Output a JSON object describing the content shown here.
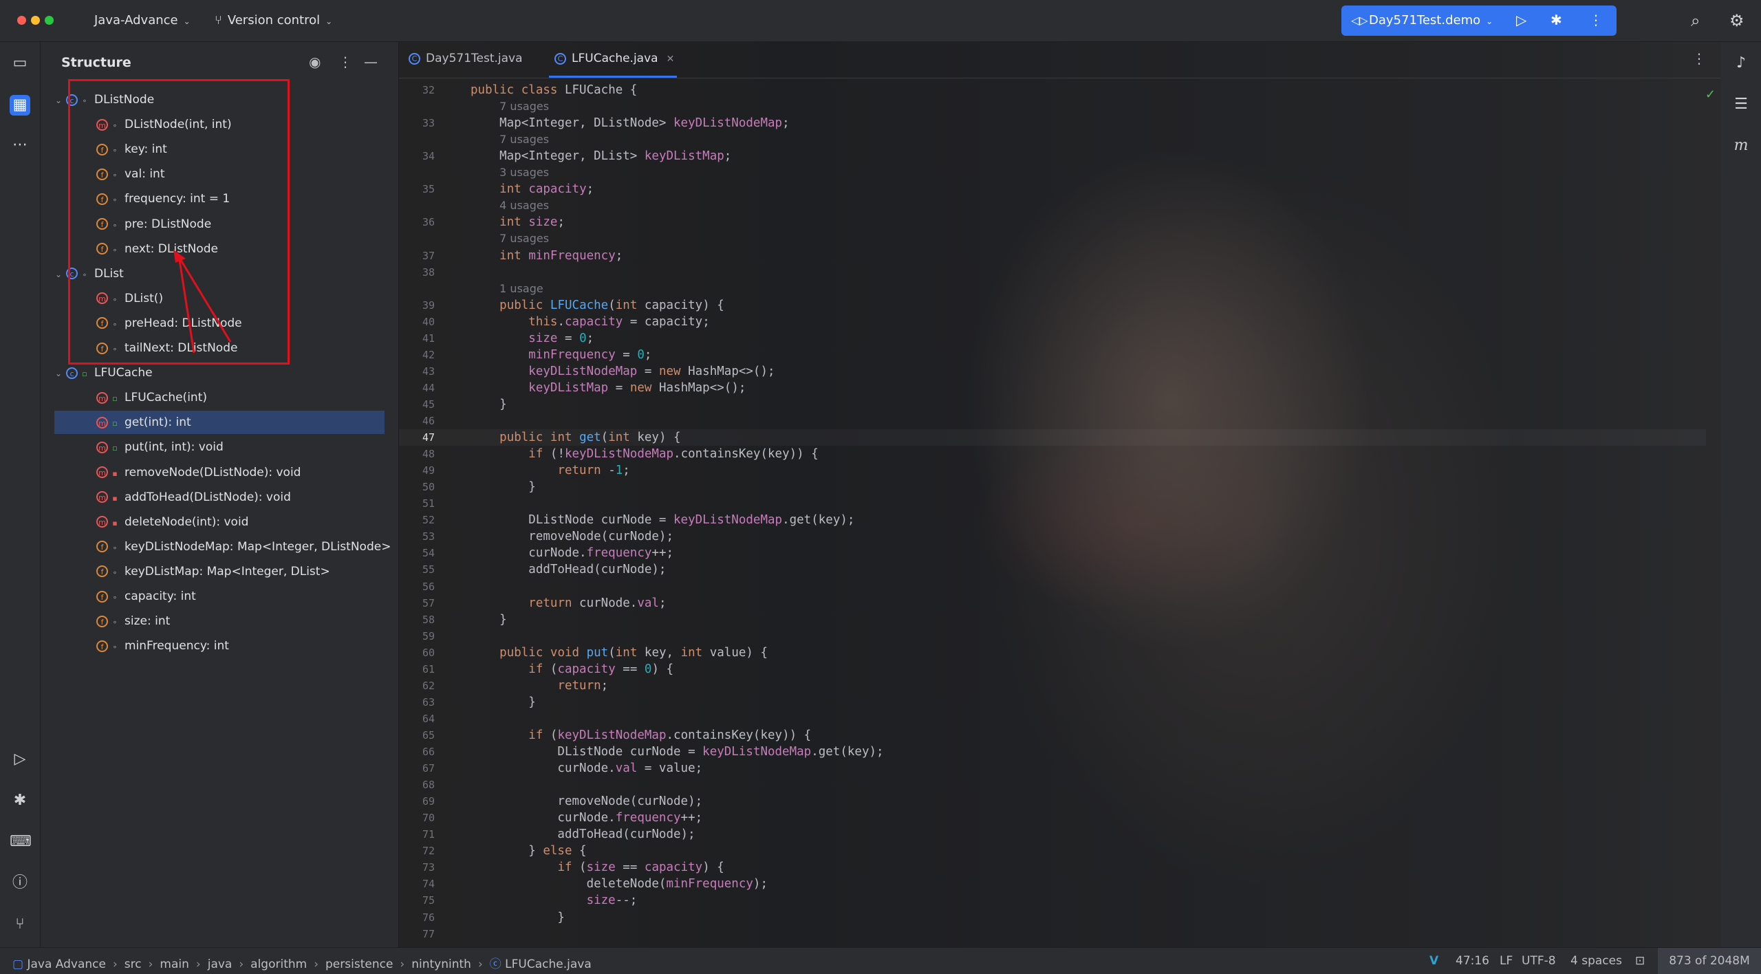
{
  "titlebar": {
    "project": "Java-Advance",
    "version_control": "Version control",
    "run_config": "Day571Test.demo"
  },
  "structure": {
    "title": "Structure",
    "items": [
      {
        "label": "DListNode",
        "kind": "c",
        "depth": 0,
        "vis": "pkg"
      },
      {
        "label": "DListNode(int, int)",
        "kind": "m",
        "depth": 1,
        "vis": "pkg"
      },
      {
        "label": "key: int",
        "kind": "f",
        "depth": 1,
        "vis": "pkg"
      },
      {
        "label": "val: int",
        "kind": "f",
        "depth": 1,
        "vis": "pkg"
      },
      {
        "label": "frequency: int = 1",
        "kind": "f",
        "depth": 1,
        "vis": "pkg"
      },
      {
        "label": "pre: DListNode",
        "kind": "f",
        "depth": 1,
        "vis": "pkg"
      },
      {
        "label": "next: DListNode",
        "kind": "f",
        "depth": 1,
        "vis": "pkg"
      },
      {
        "label": "DList",
        "kind": "c",
        "depth": 0,
        "vis": "pkg"
      },
      {
        "label": "DList()",
        "kind": "m",
        "depth": 1,
        "vis": "pkg"
      },
      {
        "label": "preHead: DListNode",
        "kind": "f",
        "depth": 1,
        "vis": "pkg"
      },
      {
        "label": "tailNext: DListNode",
        "kind": "f",
        "depth": 1,
        "vis": "pkg"
      },
      {
        "label": "LFUCache",
        "kind": "c",
        "depth": 0,
        "vis": "pub"
      },
      {
        "label": "LFUCache(int)",
        "kind": "m",
        "depth": 1,
        "vis": "pub"
      },
      {
        "label": "get(int): int",
        "kind": "m",
        "depth": 1,
        "vis": "pub",
        "selected": true
      },
      {
        "label": "put(int, int): void",
        "kind": "m",
        "depth": 1,
        "vis": "pub"
      },
      {
        "label": "removeNode(DListNode): void",
        "kind": "m",
        "depth": 1,
        "vis": "pri"
      },
      {
        "label": "addToHead(DListNode): void",
        "kind": "m",
        "depth": 1,
        "vis": "pri"
      },
      {
        "label": "deleteNode(int): void",
        "kind": "m",
        "depth": 1,
        "vis": "pri"
      },
      {
        "label": "keyDListNodeMap: Map<Integer, DListNode>",
        "kind": "f",
        "depth": 1,
        "vis": "pkg"
      },
      {
        "label": "keyDListMap: Map<Integer, DList>",
        "kind": "f",
        "depth": 1,
        "vis": "pkg"
      },
      {
        "label": "capacity: int",
        "kind": "f",
        "depth": 1,
        "vis": "pkg"
      },
      {
        "label": "size: int",
        "kind": "f",
        "depth": 1,
        "vis": "pkg"
      },
      {
        "label": "minFrequency: int",
        "kind": "f",
        "depth": 1,
        "vis": "pkg"
      }
    ]
  },
  "tabs": [
    {
      "label": "Day571Test.java",
      "active": false
    },
    {
      "label": "LFUCache.java",
      "active": true
    }
  ],
  "code_lines": [
    {
      "n": "32",
      "html": "<span class='kw'>public class</span> LFUCache {"
    },
    {
      "n": "",
      "hint": "7 usages",
      "indent": 4
    },
    {
      "n": "33",
      "html": "    Map&lt;Integer, DListNode&gt; <span class='fld'>keyDListNodeMap</span>;"
    },
    {
      "n": "",
      "hint": "7 usages",
      "indent": 4
    },
    {
      "n": "34",
      "html": "    Map&lt;Integer, DList&gt; <span class='fld'>keyDListMap</span>;"
    },
    {
      "n": "",
      "hint": "3 usages",
      "indent": 4
    },
    {
      "n": "35",
      "html": "    <span class='kw'>int</span> <span class='fld'>capacity</span>;"
    },
    {
      "n": "",
      "hint": "4 usages",
      "indent": 4
    },
    {
      "n": "36",
      "html": "    <span class='kw'>int</span> <span class='fld'>size</span>;"
    },
    {
      "n": "",
      "hint": "7 usages",
      "indent": 4
    },
    {
      "n": "37",
      "html": "    <span class='kw'>int</span> <span class='fld'>minFrequency</span>;"
    },
    {
      "n": "38",
      "html": ""
    },
    {
      "n": "",
      "hint": "1 usage",
      "indent": 4
    },
    {
      "n": "39",
      "html": "    <span class='kw'>public</span> <span class='fnd'>LFUCache</span>(<span class='kw'>int</span> capacity) {"
    },
    {
      "n": "40",
      "html": "        <span class='kw'>this</span>.<span class='fld'>capacity</span> = capacity;"
    },
    {
      "n": "41",
      "html": "        <span class='fld'>size</span> = <span class='num'>0</span>;"
    },
    {
      "n": "42",
      "html": "        <span class='fld'>minFrequency</span> = <span class='num'>0</span>;"
    },
    {
      "n": "43",
      "html": "        <span class='fld'>keyDListNodeMap</span> = <span class='kw'>new</span> HashMap&lt;&gt;();"
    },
    {
      "n": "44",
      "html": "        <span class='fld'>keyDListMap</span> = <span class='kw'>new</span> HashMap&lt;&gt;();"
    },
    {
      "n": "45",
      "html": "    }"
    },
    {
      "n": "46",
      "html": ""
    },
    {
      "n": "47",
      "html": "    <span class='kw'>public int</span> <span class='fnd'>get</span>(<span class='kw'>int</span> key) {",
      "current": true
    },
    {
      "n": "48",
      "html": "        <span class='kw'>if</span> (!<span class='fld'>keyDListNodeMap</span>.containsKey(key)) {"
    },
    {
      "n": "49",
      "html": "            <span class='kw'>return</span> -<span class='num'>1</span>;"
    },
    {
      "n": "50",
      "html": "        }"
    },
    {
      "n": "51",
      "html": ""
    },
    {
      "n": "52",
      "html": "        DListNode curNode = <span class='fld'>keyDListNodeMap</span>.get(key);"
    },
    {
      "n": "53",
      "html": "        removeNode(curNode);"
    },
    {
      "n": "54",
      "html": "        curNode.<span class='fld'>frequency</span>++;"
    },
    {
      "n": "55",
      "html": "        addToHead(curNode);"
    },
    {
      "n": "56",
      "html": ""
    },
    {
      "n": "57",
      "html": "        <span class='kw'>return</span> curNode.<span class='fld'>val</span>;"
    },
    {
      "n": "58",
      "html": "    }"
    },
    {
      "n": "59",
      "html": ""
    },
    {
      "n": "60",
      "html": "    <span class='kw'>public void</span> <span class='fnd'>put</span>(<span class='kw'>int</span> key, <span class='kw'>int</span> value) {"
    },
    {
      "n": "61",
      "html": "        <span class='kw'>if</span> (<span class='fld'>capacity</span> == <span class='num'>0</span>) {"
    },
    {
      "n": "62",
      "html": "            <span class='kw'>return</span>;"
    },
    {
      "n": "63",
      "html": "        }"
    },
    {
      "n": "64",
      "html": ""
    },
    {
      "n": "65",
      "html": "        <span class='kw'>if</span> (<span class='fld'>keyDListNodeMap</span>.containsKey(key)) {"
    },
    {
      "n": "66",
      "html": "            DListNode curNode = <span class='fld'>keyDListNodeMap</span>.get(key);"
    },
    {
      "n": "67",
      "html": "            curNode.<span class='fld'>val</span> = value;"
    },
    {
      "n": "68",
      "html": ""
    },
    {
      "n": "69",
      "html": "            removeNode(curNode);"
    },
    {
      "n": "70",
      "html": "            curNode.<span class='fld'>frequency</span>++;"
    },
    {
      "n": "71",
      "html": "            addToHead(curNode);"
    },
    {
      "n": "72",
      "html": "        } <span class='kw'>else</span> {"
    },
    {
      "n": "73",
      "html": "            <span class='kw'>if</span> (<span class='fld'>size</span> == <span class='fld'>capacity</span>) {"
    },
    {
      "n": "74",
      "html": "                deleteNode(<span class='fld'>minFrequency</span>);"
    },
    {
      "n": "75",
      "html": "                <span class='fld'>size</span>--;"
    },
    {
      "n": "76",
      "html": "            }"
    },
    {
      "n": "77",
      "html": ""
    }
  ],
  "statusbar": {
    "crumbs": [
      "Java Advance",
      "src",
      "main",
      "java",
      "algorithm",
      "persistence",
      "nintyninth",
      "LFUCache.java"
    ],
    "position": "47:16",
    "line_sep": "LF",
    "encoding": "UTF-8",
    "indent": "4 spaces",
    "memory": "873 of 2048M"
  }
}
